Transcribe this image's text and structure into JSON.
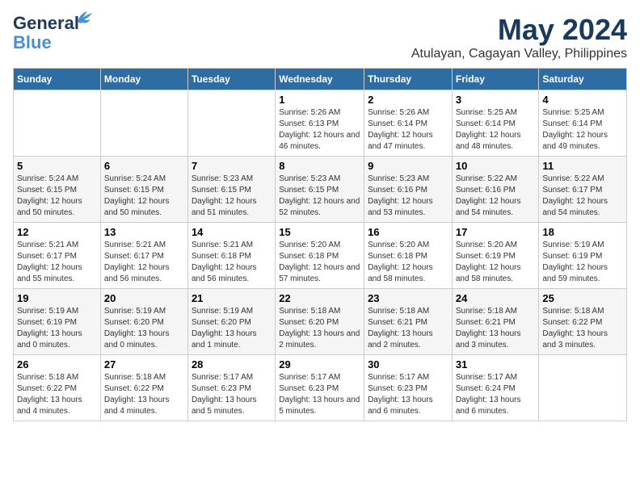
{
  "header": {
    "logo_line1": "General",
    "logo_line2": "Blue",
    "title": "May 2024",
    "subtitle": "Atulayan, Cagayan Valley, Philippines"
  },
  "weekdays": [
    "Sunday",
    "Monday",
    "Tuesday",
    "Wednesday",
    "Thursday",
    "Friday",
    "Saturday"
  ],
  "weeks": [
    [
      {
        "day": "",
        "info": ""
      },
      {
        "day": "",
        "info": ""
      },
      {
        "day": "",
        "info": ""
      },
      {
        "day": "1",
        "info": "Sunrise: 5:26 AM\nSunset: 6:13 PM\nDaylight: 12 hours\nand 46 minutes."
      },
      {
        "day": "2",
        "info": "Sunrise: 5:26 AM\nSunset: 6:14 PM\nDaylight: 12 hours\nand 47 minutes."
      },
      {
        "day": "3",
        "info": "Sunrise: 5:25 AM\nSunset: 6:14 PM\nDaylight: 12 hours\nand 48 minutes."
      },
      {
        "day": "4",
        "info": "Sunrise: 5:25 AM\nSunset: 6:14 PM\nDaylight: 12 hours\nand 49 minutes."
      }
    ],
    [
      {
        "day": "5",
        "info": "Sunrise: 5:24 AM\nSunset: 6:15 PM\nDaylight: 12 hours\nand 50 minutes."
      },
      {
        "day": "6",
        "info": "Sunrise: 5:24 AM\nSunset: 6:15 PM\nDaylight: 12 hours\nand 50 minutes."
      },
      {
        "day": "7",
        "info": "Sunrise: 5:23 AM\nSunset: 6:15 PM\nDaylight: 12 hours\nand 51 minutes."
      },
      {
        "day": "8",
        "info": "Sunrise: 5:23 AM\nSunset: 6:15 PM\nDaylight: 12 hours\nand 52 minutes."
      },
      {
        "day": "9",
        "info": "Sunrise: 5:23 AM\nSunset: 6:16 PM\nDaylight: 12 hours\nand 53 minutes."
      },
      {
        "day": "10",
        "info": "Sunrise: 5:22 AM\nSunset: 6:16 PM\nDaylight: 12 hours\nand 54 minutes."
      },
      {
        "day": "11",
        "info": "Sunrise: 5:22 AM\nSunset: 6:17 PM\nDaylight: 12 hours\nand 54 minutes."
      }
    ],
    [
      {
        "day": "12",
        "info": "Sunrise: 5:21 AM\nSunset: 6:17 PM\nDaylight: 12 hours\nand 55 minutes."
      },
      {
        "day": "13",
        "info": "Sunrise: 5:21 AM\nSunset: 6:17 PM\nDaylight: 12 hours\nand 56 minutes."
      },
      {
        "day": "14",
        "info": "Sunrise: 5:21 AM\nSunset: 6:18 PM\nDaylight: 12 hours\nand 56 minutes."
      },
      {
        "day": "15",
        "info": "Sunrise: 5:20 AM\nSunset: 6:18 PM\nDaylight: 12 hours\nand 57 minutes."
      },
      {
        "day": "16",
        "info": "Sunrise: 5:20 AM\nSunset: 6:18 PM\nDaylight: 12 hours\nand 58 minutes."
      },
      {
        "day": "17",
        "info": "Sunrise: 5:20 AM\nSunset: 6:19 PM\nDaylight: 12 hours\nand 58 minutes."
      },
      {
        "day": "18",
        "info": "Sunrise: 5:19 AM\nSunset: 6:19 PM\nDaylight: 12 hours\nand 59 minutes."
      }
    ],
    [
      {
        "day": "19",
        "info": "Sunrise: 5:19 AM\nSunset: 6:19 PM\nDaylight: 13 hours\nand 0 minutes."
      },
      {
        "day": "20",
        "info": "Sunrise: 5:19 AM\nSunset: 6:20 PM\nDaylight: 13 hours\nand 0 minutes."
      },
      {
        "day": "21",
        "info": "Sunrise: 5:19 AM\nSunset: 6:20 PM\nDaylight: 13 hours\nand 1 minute."
      },
      {
        "day": "22",
        "info": "Sunrise: 5:18 AM\nSunset: 6:20 PM\nDaylight: 13 hours\nand 2 minutes."
      },
      {
        "day": "23",
        "info": "Sunrise: 5:18 AM\nSunset: 6:21 PM\nDaylight: 13 hours\nand 2 minutes."
      },
      {
        "day": "24",
        "info": "Sunrise: 5:18 AM\nSunset: 6:21 PM\nDaylight: 13 hours\nand 3 minutes."
      },
      {
        "day": "25",
        "info": "Sunrise: 5:18 AM\nSunset: 6:22 PM\nDaylight: 13 hours\nand 3 minutes."
      }
    ],
    [
      {
        "day": "26",
        "info": "Sunrise: 5:18 AM\nSunset: 6:22 PM\nDaylight: 13 hours\nand 4 minutes."
      },
      {
        "day": "27",
        "info": "Sunrise: 5:18 AM\nSunset: 6:22 PM\nDaylight: 13 hours\nand 4 minutes."
      },
      {
        "day": "28",
        "info": "Sunrise: 5:17 AM\nSunset: 6:23 PM\nDaylight: 13 hours\nand 5 minutes."
      },
      {
        "day": "29",
        "info": "Sunrise: 5:17 AM\nSunset: 6:23 PM\nDaylight: 13 hours\nand 5 minutes."
      },
      {
        "day": "30",
        "info": "Sunrise: 5:17 AM\nSunset: 6:23 PM\nDaylight: 13 hours\nand 6 minutes."
      },
      {
        "day": "31",
        "info": "Sunrise: 5:17 AM\nSunset: 6:24 PM\nDaylight: 13 hours\nand 6 minutes."
      },
      {
        "day": "",
        "info": ""
      }
    ]
  ]
}
